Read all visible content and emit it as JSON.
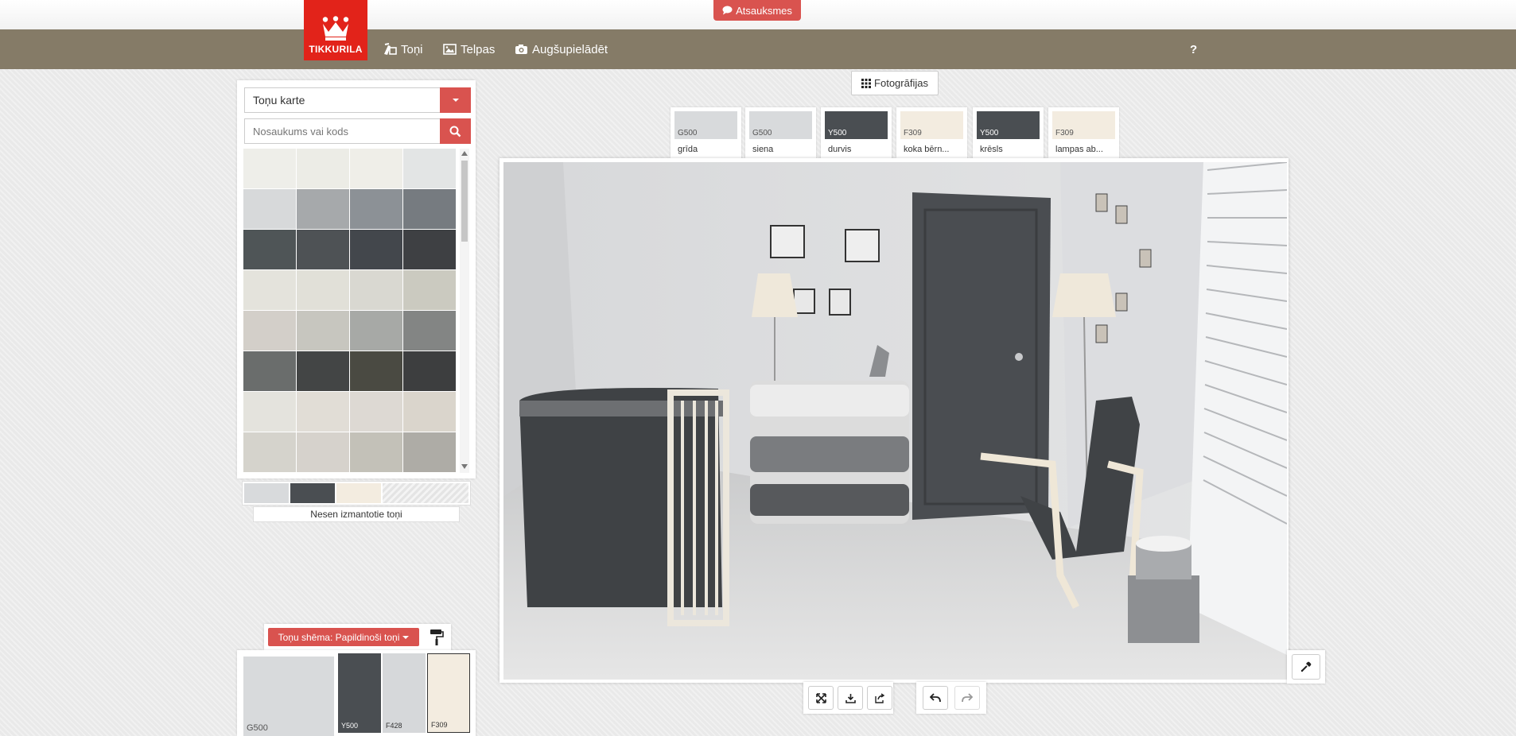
{
  "feedback": {
    "label": "Atsauksmes",
    "icon": "comment-icon"
  },
  "nav": {
    "logo_text": "TIKKURILA",
    "items": [
      {
        "label": "Toņi",
        "icon": "paint-icon"
      },
      {
        "label": "Telpas",
        "icon": "image-icon"
      },
      {
        "label": "Augšupielādēt",
        "icon": "camera-icon"
      }
    ],
    "help": "?"
  },
  "left": {
    "select_value": "Toņu karte",
    "search_placeholder": "Nosaukums vai kods",
    "grid_colors": [
      "#eeeee9",
      "#ecece6",
      "#efeee8",
      "#e3e5e5",
      "#d7d9da",
      "#a6a9ab",
      "#8c9196",
      "#767b80",
      "#4f5557",
      "#4e5255",
      "#43474c",
      "#3e4043",
      "#e4e3dc",
      "#e1e0d8",
      "#d9d8d1",
      "#cbcac0",
      "#d3cfc9",
      "#c7c6bf",
      "#a7a9a6",
      "#838584",
      "#6a6d6c",
      "#434545",
      "#4a4a42",
      "#3d3e3f",
      "#e4e3dd",
      "#e1ddd6",
      "#ddd9d3",
      "#dad5cc",
      "#d5d3cc",
      "#d6d2cc",
      "#c3c1b8",
      "#aeaca6"
    ],
    "recent_colors": [
      "#d8dadc",
      "#4a4e52",
      "#f3ece0"
    ],
    "recent_label": "Nesen izmantotie toņi"
  },
  "scheme": {
    "button_label": "Toņu shēma: Papildinoši toņi",
    "swatches": [
      {
        "code": "G500",
        "color": "#d8dadc",
        "text_color": "#555555"
      },
      {
        "code": "Y500",
        "color": "#4a4e52",
        "text_color": "#ffffff"
      },
      {
        "code": "F428",
        "color": "#d6d8da",
        "text_color": "#333333"
      },
      {
        "code": "F309",
        "color": "#f3ece0",
        "text_color": "#333333"
      }
    ]
  },
  "photos_tab": {
    "label": "Fotogrāfijas",
    "icon": "grid-icon"
  },
  "surfaces": [
    {
      "code": "G500",
      "name": "grīda",
      "color": "#d8dadc",
      "text_color": "#555555"
    },
    {
      "code": "G500",
      "name": "siena",
      "color": "#d8dadc",
      "text_color": "#555555"
    },
    {
      "code": "Y500",
      "name": "durvis",
      "color": "#4a4e52",
      "text_color": "#ffffff"
    },
    {
      "code": "F309",
      "name": "koka bērn...",
      "color": "#f3ece0",
      "text_color": "#555555"
    },
    {
      "code": "Y500",
      "name": "krēsls",
      "color": "#4a4e52",
      "text_color": "#ffffff"
    },
    {
      "code": "F309",
      "name": "lampas ab...",
      "color": "#f3ece0",
      "text_color": "#555555"
    }
  ],
  "toolbar": {
    "buttons": [
      "fullscreen-icon",
      "download-icon",
      "share-icon",
      "undo-icon",
      "redo-icon"
    ]
  },
  "picker": {
    "icon": "eyedropper-icon"
  }
}
